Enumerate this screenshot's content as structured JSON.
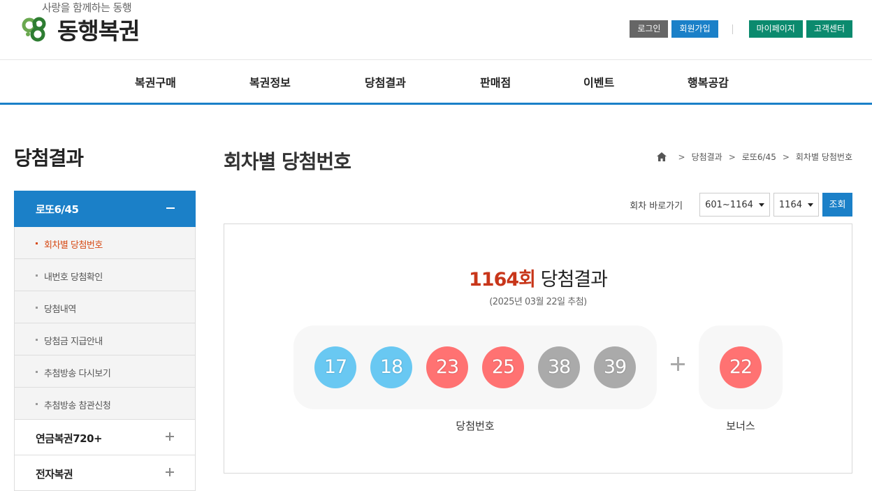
{
  "header": {
    "slogan": "사랑을 함께하는 동행",
    "brand": "동행복권",
    "login": "로그인",
    "signup": "회원가입",
    "mypage": "마이페이지",
    "support": "고객센터"
  },
  "gnb": [
    "복권구매",
    "복권정보",
    "당첨결과",
    "판매점",
    "이벤트",
    "행복공감"
  ],
  "lnb": {
    "title": "당첨결과",
    "open_group": "로또6/45",
    "sub_items": [
      "회차별 당첨번호",
      "내번호 당첨확인",
      "당첨내역",
      "당첨금 지급안내",
      "추첨방송 다시보기",
      "추첨방송 참관신청"
    ],
    "groups": [
      "연금복권720+",
      "전자복권"
    ]
  },
  "content": {
    "title": "회차별 당첨번호",
    "breadcrumb": [
      "당첨결과",
      "로또6/45",
      "회차별 당첨번호"
    ],
    "goto_label": "회차 바로가기",
    "range_select": "601~1164",
    "round_select": "1164",
    "search_button": "조회"
  },
  "result": {
    "round": "1164회",
    "title_suffix": " 당첨결과",
    "date": "(2025년 03월 22일 추첨)",
    "numbers": [
      {
        "n": "17",
        "color": "#69c8f2"
      },
      {
        "n": "18",
        "color": "#69c8f2"
      },
      {
        "n": "23",
        "color": "#ff7272"
      },
      {
        "n": "25",
        "color": "#ff7272"
      },
      {
        "n": "38",
        "color": "#aaaaaa"
      },
      {
        "n": "39",
        "color": "#aaaaaa"
      }
    ],
    "bonus": {
      "n": "22",
      "color": "#ff7272"
    },
    "numbers_caption": "당첨번호",
    "bonus_caption": "보너스"
  },
  "colors": {
    "primary": "#1b80c8",
    "accent": "#c8361a",
    "teal": "#0b8a6e"
  }
}
